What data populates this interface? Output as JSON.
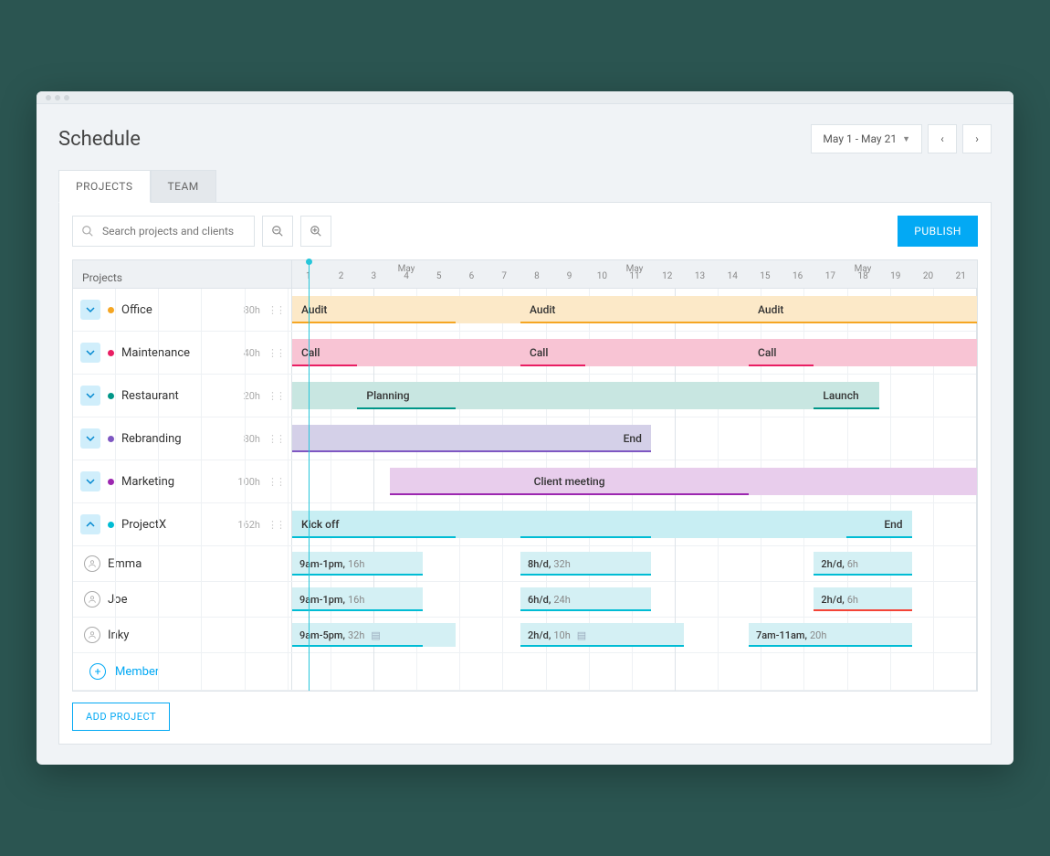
{
  "page_title": "Schedule",
  "date_range": "May 1 - May 21",
  "tabs": {
    "projects": "PROJECTS",
    "team": "TEAM"
  },
  "search_placeholder": "Search projects and clients",
  "publish": "PUBLISH",
  "projects_header": "Projects",
  "month": "May",
  "days": [
    "1",
    "2",
    "3",
    "4",
    "5",
    "6",
    "7",
    "8",
    "9",
    "10",
    "11",
    "12",
    "13",
    "14",
    "15",
    "16",
    "17",
    "18",
    "19",
    "20",
    "21"
  ],
  "projects": [
    {
      "name": "Office",
      "hours": "80h",
      "color": "#f5a623",
      "bgcolor": "#fce9c8",
      "bars": [
        {
          "start": 0,
          "segments": [
            [
              0,
              5
            ],
            [
              7,
              7
            ],
            [
              14,
              7
            ]
          ],
          "label": "Audit"
        }
      ]
    },
    {
      "name": "Maintenance",
      "hours": "40h",
      "color": "#e91e63",
      "bgcolor": "#f8c4d4",
      "bars": [
        {
          "segments": [
            [
              0,
              2
            ],
            [
              7,
              2
            ],
            [
              14,
              2
            ]
          ],
          "bg_full": true,
          "labels": [
            "Call",
            "Call",
            "Call"
          ]
        }
      ]
    },
    {
      "name": "Restaurant",
      "hours": "20h",
      "color": "#009688",
      "bgcolor": "#c8e6e1",
      "bars": [
        {
          "segments": [
            [
              2,
              3
            ],
            [
              16,
              2
            ]
          ],
          "bg_span": [
            0,
            18
          ],
          "labels": [
            "Planning",
            "Launch"
          ]
        }
      ]
    },
    {
      "name": "Rebranding",
      "hours": "80h",
      "color": "#7e57c2",
      "bgcolor": "#d4d0e8",
      "bars": [
        {
          "segments": [
            [
              0,
              11
            ]
          ],
          "label_right": "End"
        }
      ]
    },
    {
      "name": "Marketing",
      "hours": "100h",
      "color": "#9c27b0",
      "bgcolor": "#e8cdec",
      "bars": [
        {
          "segments": [
            [
              3,
              11
            ]
          ],
          "bg_span": [
            3,
            18
          ],
          "label": "Client meeting",
          "center": true
        }
      ]
    },
    {
      "name": "ProjectX",
      "hours": "162h",
      "color": "#00bcd4",
      "bgcolor": "#c8eef3",
      "expanded": true,
      "bars": [
        {
          "segments": [
            [
              0,
              5
            ],
            [
              7,
              4
            ],
            [
              17,
              2
            ]
          ],
          "bg_span": [
            0,
            19
          ],
          "labels": [
            "Kick off",
            "",
            "End"
          ],
          "right_align": [
            false,
            false,
            true
          ]
        }
      ]
    }
  ],
  "members": [
    {
      "name": "Emma",
      "icon": "👤",
      "assigns": [
        {
          "time": "9am-1pm",
          "dur": "16h",
          "seg": [
            0,
            4
          ]
        },
        {
          "time": "8h/d",
          "dur": "32h",
          "seg": [
            7,
            4
          ]
        },
        {
          "time": "2h/d",
          "dur": "6h",
          "seg": [
            16,
            3
          ]
        }
      ]
    },
    {
      "name": "Joe",
      "icon": "👤",
      "assigns": [
        {
          "time": "9am-1pm",
          "dur": "16h",
          "seg": [
            0,
            4
          ]
        },
        {
          "time": "6h/d",
          "dur": "24h",
          "seg": [
            7,
            4
          ]
        },
        {
          "time": "2h/d",
          "dur": "6h",
          "seg": [
            16,
            3
          ],
          "overbook": true
        }
      ]
    },
    {
      "name": "Inky",
      "icon": "◡",
      "assigns": [
        {
          "time": "9am-5pm",
          "dur": "32h",
          "seg": [
            0,
            4
          ],
          "note": true,
          "bg_extend": 5
        },
        {
          "time": "2h/d",
          "dur": "10h",
          "seg": [
            7,
            5
          ],
          "note": true
        },
        {
          "time": "7am-11am",
          "dur": "20h",
          "seg": [
            14,
            5
          ]
        }
      ]
    }
  ],
  "add_member": "Member",
  "add_project": "ADD PROJECT",
  "colors": {
    "cyan": "#00bcd4",
    "cyan_bg": "#d4f0f4",
    "cyan_line": "#00bcd4",
    "red": "#f44336"
  }
}
